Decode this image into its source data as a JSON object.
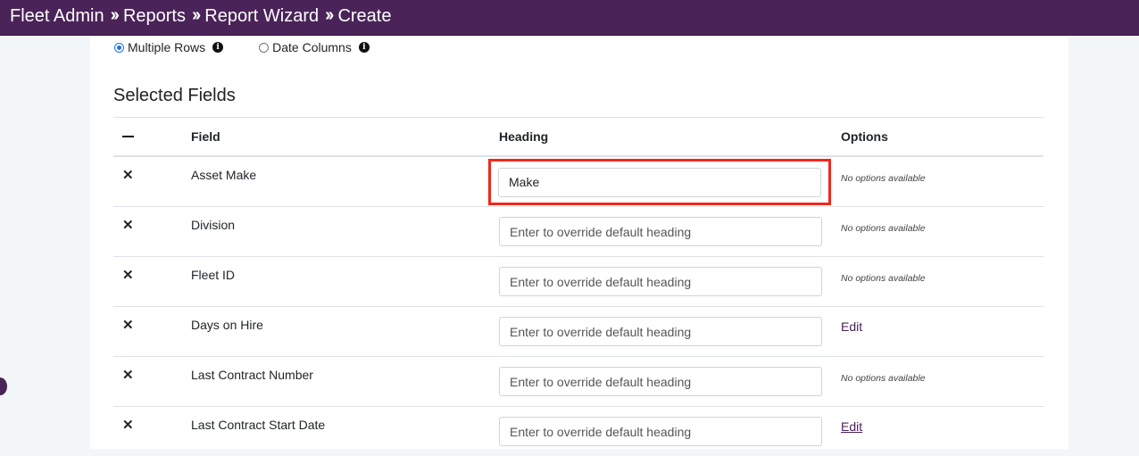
{
  "breadcrumb": {
    "items": [
      "Fleet Admin",
      "Reports",
      "Report Wizard",
      "Create"
    ],
    "separator": "»"
  },
  "layout_options": {
    "multiple_rows_label": "Multiple Rows",
    "date_columns_label": "Date Columns",
    "selected": "Multiple Rows"
  },
  "section_title": "Selected Fields",
  "table": {
    "headers": {
      "field": "Field",
      "heading": "Heading",
      "options": "Options"
    },
    "rows": [
      {
        "field": "Asset Make",
        "heading_value": "Make",
        "heading_placeholder": "",
        "options": "No options available",
        "options_type": "text",
        "highlighted": true
      },
      {
        "field": "Division",
        "heading_value": "",
        "heading_placeholder": "Enter to override default heading",
        "options": "No options available",
        "options_type": "text"
      },
      {
        "field": "Fleet ID",
        "heading_value": "",
        "heading_placeholder": "Enter to override default heading",
        "options": "No options available",
        "options_type": "text"
      },
      {
        "field": "Days on Hire",
        "heading_value": "",
        "heading_placeholder": "Enter to override default heading",
        "options": "Edit",
        "options_type": "link"
      },
      {
        "field": "Last Contract Number",
        "heading_value": "",
        "heading_placeholder": "Enter to override default heading",
        "options": "No options available",
        "options_type": "text"
      },
      {
        "field": "Last Contract Start Date",
        "heading_value": "",
        "heading_placeholder": "Enter to override default heading",
        "options": "Edit",
        "options_type": "link"
      }
    ]
  },
  "colors": {
    "header_bg": "#4a2358",
    "highlight": "#f2271b",
    "link": "#4a2358"
  },
  "icons": {
    "remove": "close-icon",
    "collapse": "minus-icon",
    "info": "info-icon"
  }
}
